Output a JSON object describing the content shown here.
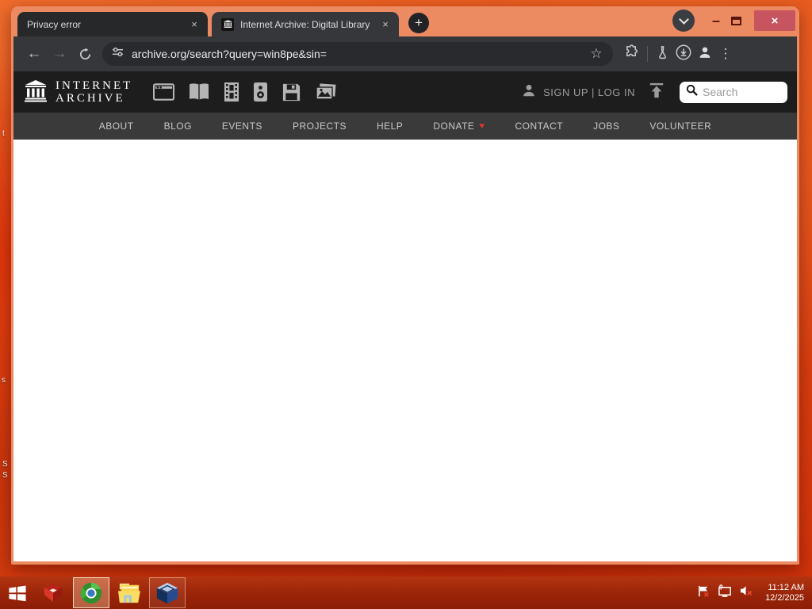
{
  "browser": {
    "tabs": [
      {
        "title": "Privacy error"
      },
      {
        "title": "Internet Archive: Digital Library"
      }
    ],
    "glyphs": {
      "tab_close": "×",
      "new_tab": "+",
      "minimize": "–",
      "window_close": "×",
      "back": "←",
      "forward": "→",
      "star": "☆",
      "menu": "⋮"
    },
    "url": "archive.org/search?query=win8pe&sin="
  },
  "ia": {
    "logo": {
      "line1": "INTERNET",
      "line2": "ARCHIVE"
    },
    "auth": "SIGN UP | LOG IN",
    "search_placeholder": "Search",
    "nav": [
      {
        "label": "ABOUT"
      },
      {
        "label": "BLOG"
      },
      {
        "label": "EVENTS"
      },
      {
        "label": "PROJECTS"
      },
      {
        "label": "HELP"
      },
      {
        "label": "DONATE",
        "heart": "♥"
      },
      {
        "label": "CONTACT"
      },
      {
        "label": "JOBS"
      },
      {
        "label": "VOLUNTEER"
      }
    ]
  },
  "taskbar": {
    "time": "11:12 AM",
    "date": "12/2/2025"
  },
  "desktop": {
    "fragments": [
      {
        "text": "t"
      },
      {
        "text": "s"
      },
      {
        "text": "S"
      },
      {
        "text": "S"
      }
    ]
  },
  "colors": {
    "frame": "#ec8a62",
    "toolbar": "#36373a",
    "ia_header": "#1d1d1e",
    "ia_nav": "#3a3a3a",
    "taskbar": "#9a2408",
    "close_button": "#c75560",
    "donate_heart": "#e03434"
  }
}
